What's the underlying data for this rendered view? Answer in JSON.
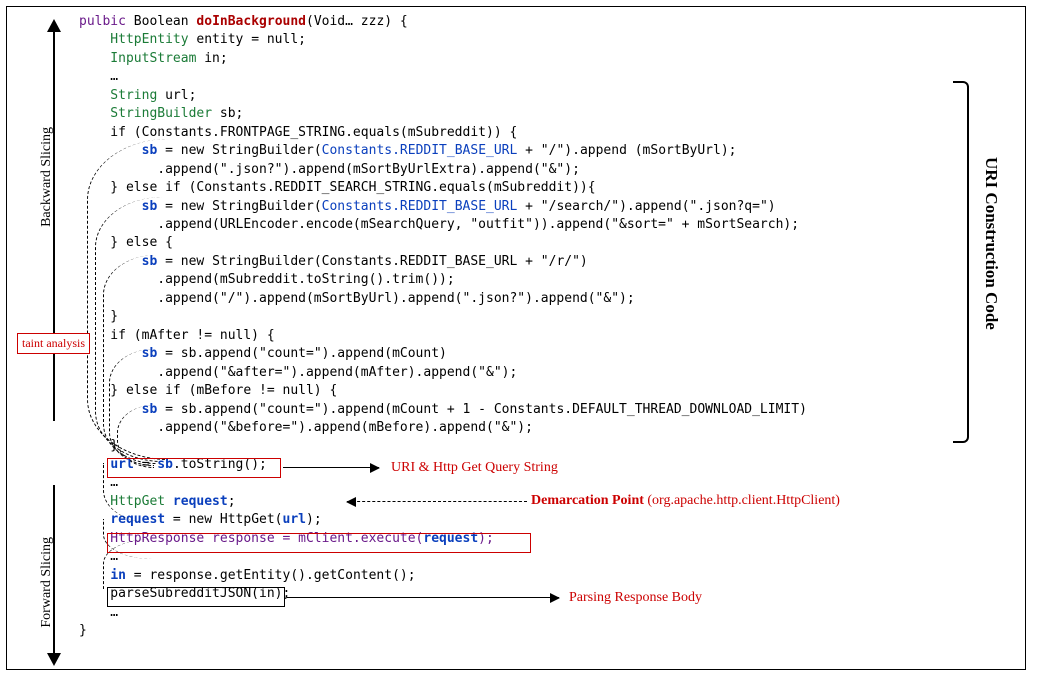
{
  "side_labels": {
    "backward": "Backward Slicing",
    "forward": "Forward Slicing",
    "right": "URI Construction Code"
  },
  "taint_label": "taint analysis",
  "annotations": {
    "uri_query": "URI & Http Get Query String",
    "demarcation": "Demarcation Point",
    "demarcation_paren": "(org.apache.http.client.HttpClient)",
    "parsing": "Parsing Response Body"
  },
  "code": {
    "l1_a": "pulbic",
    "l1_b": " Boolean ",
    "l1_c": "doInBackground",
    "l1_d": "(Void… zzz) {",
    "l2_a": "    HttpEntity",
    "l2_b": " entity = null;",
    "l3_a": "    InputStream",
    "l3_b": " in;",
    "l4": "    …",
    "l5_a": "    String",
    "l5_b": " url;",
    "l6_a": "    StringBuilder",
    "l6_b": " sb;",
    "l7": "    if (Constants.FRONTPAGE_STRING.equals(mSubreddit)) {",
    "l8_a": "        ",
    "l8_sb": "sb",
    "l8_b": " = new StringBuilder(",
    "l8_c": "Constants.REDDIT_BASE_URL",
    "l8_d": " + \"/\").append (mSortByUrl);",
    "l9": "          .append(\".json?\").append(mSortByUrlExtra).append(\"&\");",
    "l10": "    } else if (Constants.REDDIT_SEARCH_STRING.equals(mSubreddit)){",
    "l11_a": "        ",
    "l11_sb": "sb",
    "l11_b": " = new StringBuilder(",
    "l11_c": "Constants.REDDIT_BASE_URL",
    "l11_d": " + \"/search/\").append(\".json?q=\")",
    "l12": "          .append(URLEncoder.encode(mSearchQuery, \"outfit\")).append(\"&sort=\" + mSortSearch);",
    "l13": "    } else {",
    "l14_a": "        ",
    "l14_sb": "sb",
    "l14_b": " = new StringBuilder(Constants.REDDIT_BASE_URL + \"/r/\")",
    "l15": "          .append(mSubreddit.toString().trim());",
    "l16": "          .append(\"/\").append(mSortByUrl).append(\".json?\").append(\"&\");",
    "l17": "    }",
    "l18": "    if (mAfter != null) {",
    "l19_a": "        ",
    "l19_sb": "sb",
    "l19_b": " = sb.append(\"count=\").append(mCount)",
    "l20": "          .append(\"&after=\").append(mAfter).append(\"&\");",
    "l21": "    } else if (mBefore != null) {",
    "l22_a": "        ",
    "l22_sb": "sb",
    "l22_b": " = sb.append(\"count=\").append(mCount + 1 - Constants.DEFAULT_THREAD_DOWNLOAD_LIMIT)",
    "l23": "          .append(\"&before=\").append(mBefore).append(\"&\");",
    "l24": "    }",
    "l25_a": "    ",
    "l25_url": "url",
    "l25_b": " = ",
    "l25_sb": "sb",
    "l25_c": ".toString();",
    "l26": "    …",
    "l27_a": "    HttpGet",
    "l27_b": " ",
    "l27_req": "request",
    "l27_c": ";",
    "l28_a": "    ",
    "l28_req": "request",
    "l28_b": " = new HttpGet(",
    "l28_url": "url",
    "l28_c": ");",
    "l29_a": "    HttpResponse response = mClient.execute(",
    "l29_req": "request",
    "l29_b": ");",
    "l30": "    …",
    "l31_a": "    ",
    "l31_in": "in",
    "l31_b": " = response.getEntity().getContent();",
    "l32": "    parseSubredditJSON(in);",
    "l33": "    …",
    "l34": "}"
  }
}
